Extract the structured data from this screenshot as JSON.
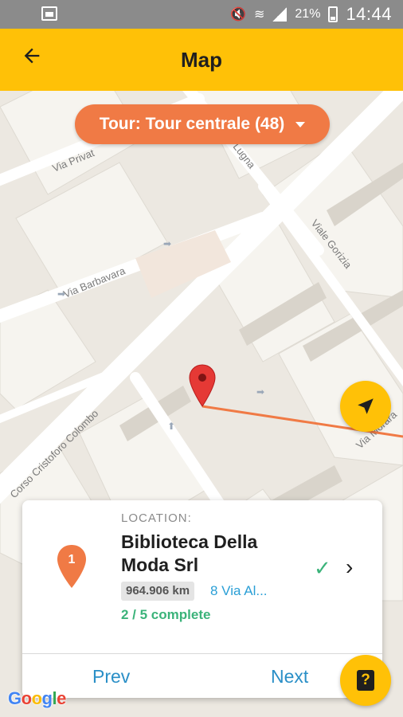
{
  "status_bar": {
    "battery_text": "21%",
    "time": "14:44"
  },
  "app_bar": {
    "title": "Map",
    "back_icon": "arrow-back-icon"
  },
  "map": {
    "streets": [
      "Via Privat",
      "Lugna",
      "Via Barbavara",
      "Viale Gorizia",
      "Corso Cristoforo Colombo",
      "Via Morara"
    ],
    "route_color": "#f07a45",
    "pin_color": "#e53935"
  },
  "tour_selector": {
    "label": "Tour: Tour centrale (48)"
  },
  "location_card": {
    "section_label": "LOCATION:",
    "name": "Biblioteca Della Moda Srl",
    "marker_number": "1",
    "distance": "964.906 km",
    "address": "8 Via Al...",
    "progress": "2 / 5 complete",
    "prev_label": "Prev",
    "next_label": "Next"
  },
  "help_fab": {
    "label": "?"
  },
  "attribution": {
    "logo": "Google"
  },
  "colors": {
    "accent": "#ffc107",
    "orange": "#f07a45",
    "link": "#2a8fc7",
    "success": "#3bb37a"
  }
}
